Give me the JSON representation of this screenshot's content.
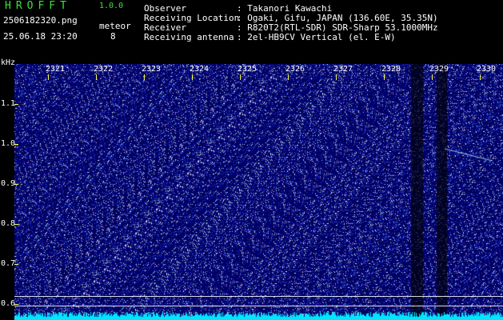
{
  "app": {
    "name": "HROFFT",
    "version": "1.0.0"
  },
  "file": {
    "name": "2506182320.png",
    "datetime": "25.06.18 23:20"
  },
  "meteor": {
    "label": "meteor",
    "count": "8"
  },
  "info": [
    {
      "key": "Observer",
      "value": ": Takanori Kawachi"
    },
    {
      "key": "Receiving Location",
      "value": ": Ogaki, Gifu, JAPAN (136.60E, 35.35N)"
    },
    {
      "key": "Receiver",
      "value": ": R820T2(RTL-SDR) SDR-Sharp 53.1000MHz"
    },
    {
      "key": "Receiving antenna",
      "value": ": 2el-HB9CV Vertical (el. E-W)"
    }
  ],
  "axis": {
    "y_unit": "kHz",
    "y_labels": [
      "1.1",
      "1.0",
      "0.9",
      "0.8",
      "0.7",
      "0.6"
    ],
    "x_labels": [
      "2321",
      "2322",
      "2323",
      "2324",
      "2325",
      "2326",
      "2327",
      "2328",
      "2329",
      "2330"
    ]
  },
  "colors": {
    "background": "#000000",
    "spectrum": "#0a0a70",
    "title": "#3ee03e",
    "accent": "#ffff3a",
    "signal": "#00e5ff"
  }
}
